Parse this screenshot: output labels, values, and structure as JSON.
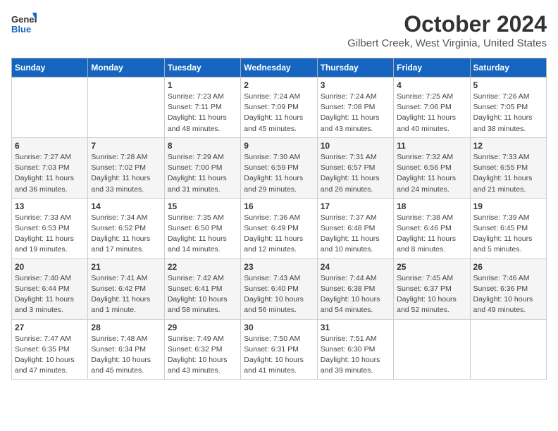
{
  "logo": {
    "general": "General",
    "blue": "Blue"
  },
  "title": "October 2024",
  "location": "Gilbert Creek, West Virginia, United States",
  "days_of_week": [
    "Sunday",
    "Monday",
    "Tuesday",
    "Wednesday",
    "Thursday",
    "Friday",
    "Saturday"
  ],
  "weeks": [
    [
      {
        "day": "",
        "info": ""
      },
      {
        "day": "",
        "info": ""
      },
      {
        "day": "1",
        "info": "Sunrise: 7:23 AM\nSunset: 7:11 PM\nDaylight: 11 hours and 48 minutes."
      },
      {
        "day": "2",
        "info": "Sunrise: 7:24 AM\nSunset: 7:09 PM\nDaylight: 11 hours and 45 minutes."
      },
      {
        "day": "3",
        "info": "Sunrise: 7:24 AM\nSunset: 7:08 PM\nDaylight: 11 hours and 43 minutes."
      },
      {
        "day": "4",
        "info": "Sunrise: 7:25 AM\nSunset: 7:06 PM\nDaylight: 11 hours and 40 minutes."
      },
      {
        "day": "5",
        "info": "Sunrise: 7:26 AM\nSunset: 7:05 PM\nDaylight: 11 hours and 38 minutes."
      }
    ],
    [
      {
        "day": "6",
        "info": "Sunrise: 7:27 AM\nSunset: 7:03 PM\nDaylight: 11 hours and 36 minutes."
      },
      {
        "day": "7",
        "info": "Sunrise: 7:28 AM\nSunset: 7:02 PM\nDaylight: 11 hours and 33 minutes."
      },
      {
        "day": "8",
        "info": "Sunrise: 7:29 AM\nSunset: 7:00 PM\nDaylight: 11 hours and 31 minutes."
      },
      {
        "day": "9",
        "info": "Sunrise: 7:30 AM\nSunset: 6:59 PM\nDaylight: 11 hours and 29 minutes."
      },
      {
        "day": "10",
        "info": "Sunrise: 7:31 AM\nSunset: 6:57 PM\nDaylight: 11 hours and 26 minutes."
      },
      {
        "day": "11",
        "info": "Sunrise: 7:32 AM\nSunset: 6:56 PM\nDaylight: 11 hours and 24 minutes."
      },
      {
        "day": "12",
        "info": "Sunrise: 7:33 AM\nSunset: 6:55 PM\nDaylight: 11 hours and 21 minutes."
      }
    ],
    [
      {
        "day": "13",
        "info": "Sunrise: 7:33 AM\nSunset: 6:53 PM\nDaylight: 11 hours and 19 minutes."
      },
      {
        "day": "14",
        "info": "Sunrise: 7:34 AM\nSunset: 6:52 PM\nDaylight: 11 hours and 17 minutes."
      },
      {
        "day": "15",
        "info": "Sunrise: 7:35 AM\nSunset: 6:50 PM\nDaylight: 11 hours and 14 minutes."
      },
      {
        "day": "16",
        "info": "Sunrise: 7:36 AM\nSunset: 6:49 PM\nDaylight: 11 hours and 12 minutes."
      },
      {
        "day": "17",
        "info": "Sunrise: 7:37 AM\nSunset: 6:48 PM\nDaylight: 11 hours and 10 minutes."
      },
      {
        "day": "18",
        "info": "Sunrise: 7:38 AM\nSunset: 6:46 PM\nDaylight: 11 hours and 8 minutes."
      },
      {
        "day": "19",
        "info": "Sunrise: 7:39 AM\nSunset: 6:45 PM\nDaylight: 11 hours and 5 minutes."
      }
    ],
    [
      {
        "day": "20",
        "info": "Sunrise: 7:40 AM\nSunset: 6:44 PM\nDaylight: 11 hours and 3 minutes."
      },
      {
        "day": "21",
        "info": "Sunrise: 7:41 AM\nSunset: 6:42 PM\nDaylight: 11 hours and 1 minute."
      },
      {
        "day": "22",
        "info": "Sunrise: 7:42 AM\nSunset: 6:41 PM\nDaylight: 10 hours and 58 minutes."
      },
      {
        "day": "23",
        "info": "Sunrise: 7:43 AM\nSunset: 6:40 PM\nDaylight: 10 hours and 56 minutes."
      },
      {
        "day": "24",
        "info": "Sunrise: 7:44 AM\nSunset: 6:38 PM\nDaylight: 10 hours and 54 minutes."
      },
      {
        "day": "25",
        "info": "Sunrise: 7:45 AM\nSunset: 6:37 PM\nDaylight: 10 hours and 52 minutes."
      },
      {
        "day": "26",
        "info": "Sunrise: 7:46 AM\nSunset: 6:36 PM\nDaylight: 10 hours and 49 minutes."
      }
    ],
    [
      {
        "day": "27",
        "info": "Sunrise: 7:47 AM\nSunset: 6:35 PM\nDaylight: 10 hours and 47 minutes."
      },
      {
        "day": "28",
        "info": "Sunrise: 7:48 AM\nSunset: 6:34 PM\nDaylight: 10 hours and 45 minutes."
      },
      {
        "day": "29",
        "info": "Sunrise: 7:49 AM\nSunset: 6:32 PM\nDaylight: 10 hours and 43 minutes."
      },
      {
        "day": "30",
        "info": "Sunrise: 7:50 AM\nSunset: 6:31 PM\nDaylight: 10 hours and 41 minutes."
      },
      {
        "day": "31",
        "info": "Sunrise: 7:51 AM\nSunset: 6:30 PM\nDaylight: 10 hours and 39 minutes."
      },
      {
        "day": "",
        "info": ""
      },
      {
        "day": "",
        "info": ""
      }
    ]
  ]
}
